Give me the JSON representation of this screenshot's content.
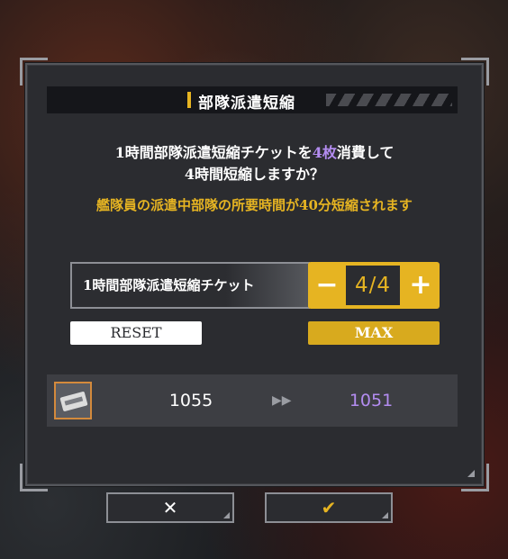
{
  "dialog": {
    "title": "部隊派遣短縮",
    "message_line1_pre": "1時間部隊派遣短縮チケットを",
    "message_line1_highlight": "4枚",
    "message_line1_post": "消費して",
    "message_line2": "4時間短縮しますか？",
    "note": "艦隊員の派遣中部隊の所要時間が40分短縮されます"
  },
  "ticket": {
    "label": "1時間部隊派遣短縮チケット",
    "minus_icon": "−",
    "plus_icon": "+",
    "count": "4/4"
  },
  "buttons": {
    "reset": "RESET",
    "max": "MAX",
    "cancel_icon": "✕",
    "confirm_icon": "✔"
  },
  "result": {
    "before": "1055",
    "arrow": "▶▶",
    "after": "1051"
  },
  "colors": {
    "accent": "#e6b422",
    "highlight": "#b38cf0",
    "panel": "#2b2c30"
  }
}
